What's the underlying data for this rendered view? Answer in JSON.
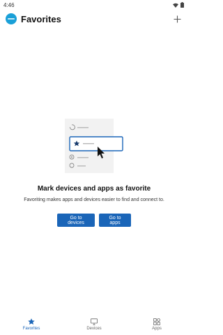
{
  "status_bar": {
    "time": "4:46"
  },
  "header": {
    "title": "Favorites",
    "add_icon": "plus-icon",
    "logo_icon": "phone-link-logo"
  },
  "empty_state": {
    "title": "Mark devices and apps as favorite",
    "subtitle": "Favoriting makes apps and devices easier to find and connect to."
  },
  "actions": {
    "devices_label": "Go to devices",
    "apps_label": "Go to apps"
  },
  "bottom_nav": {
    "items": [
      {
        "label": "Favorites",
        "icon": "star-icon",
        "active": true
      },
      {
        "label": "Devices",
        "icon": "monitor-icon",
        "active": false
      },
      {
        "label": "Apps",
        "icon": "grid-icon",
        "active": false
      }
    ]
  },
  "colors": {
    "accent": "#1a65b8",
    "illustration_card": "#f2f2f2",
    "inactive": "#666666"
  }
}
